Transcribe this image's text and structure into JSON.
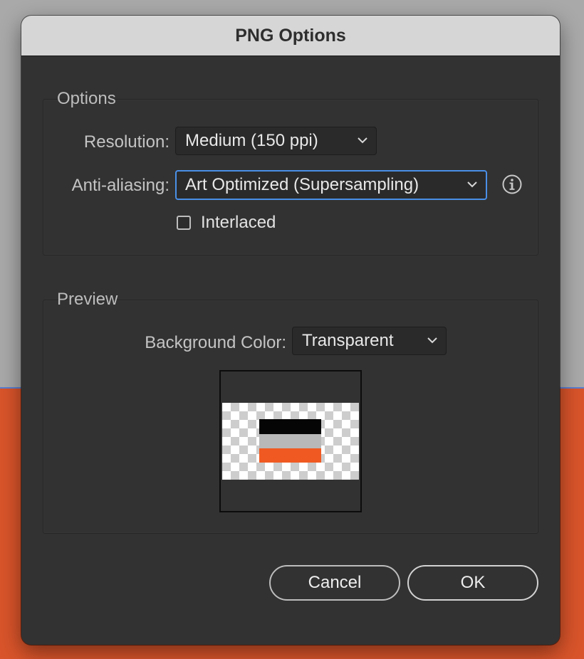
{
  "dialog": {
    "title": "PNG Options"
  },
  "options_group": {
    "legend": "Options",
    "resolution": {
      "label": "Resolution:",
      "value": "Medium (150 ppi)"
    },
    "anti_aliasing": {
      "label": "Anti-aliasing:",
      "value": "Art Optimized (Supersampling)"
    },
    "interlaced": {
      "label": "Interlaced",
      "checked": false
    },
    "info_icon": "info-circle-icon"
  },
  "preview_group": {
    "legend": "Preview",
    "background_color": {
      "label": "Background Color:",
      "value": "Transparent"
    },
    "thumbnail_colors": [
      "#050505",
      "#b8b8b8",
      "#f05a22"
    ]
  },
  "buttons": {
    "cancel": "Cancel",
    "ok": "OK"
  },
  "colors": {
    "dialog_bg": "#323232",
    "titlebar_bg": "#d6d6d6",
    "focus_ring": "#4a8fe7",
    "backdrop_orange": "#d9542a"
  }
}
